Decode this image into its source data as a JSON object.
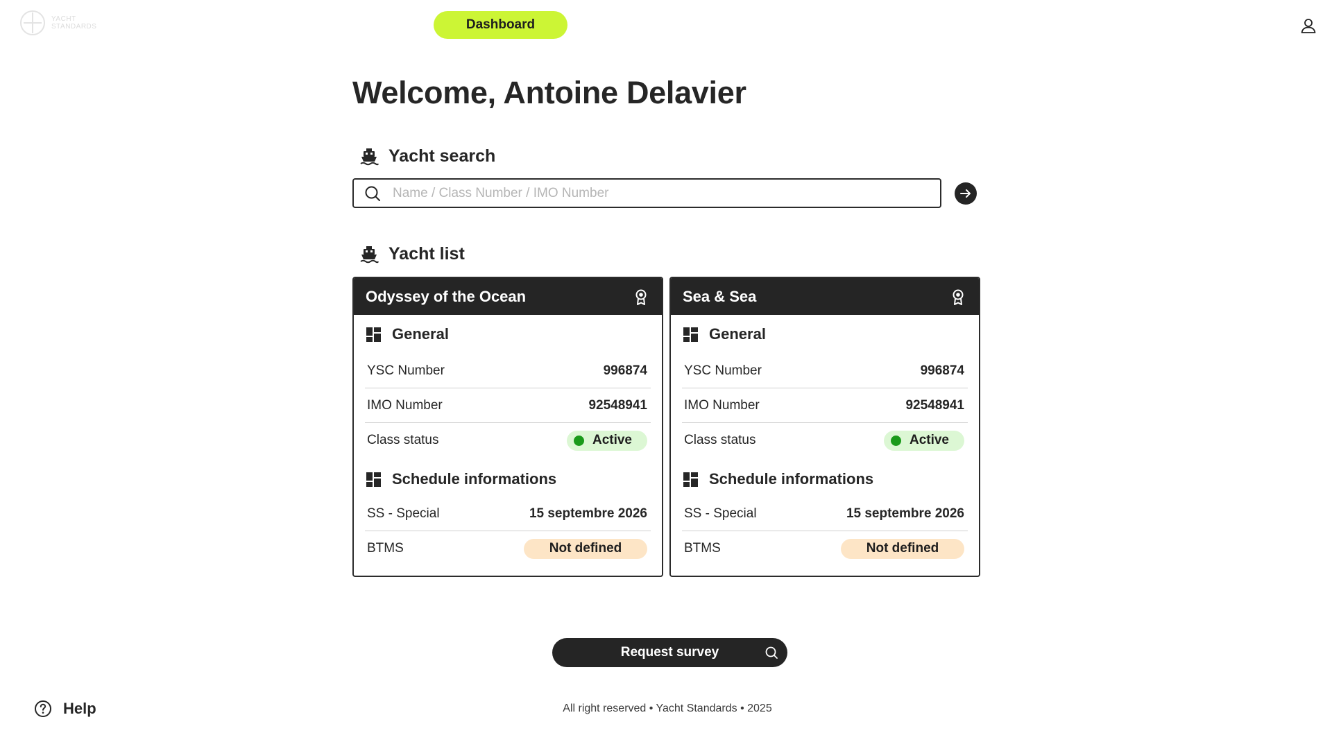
{
  "header": {
    "logo_text_line1": "YACHT",
    "logo_text_line2": "STANDARDS",
    "dashboard_label": "Dashboard"
  },
  "welcome": {
    "title": "Welcome, Antoine Delavier"
  },
  "search": {
    "title": "Yacht search",
    "placeholder": "Name / Class Number / IMO Number",
    "value": ""
  },
  "yacht_list": {
    "title": "Yacht list",
    "yachts": [
      {
        "name": "Odyssey of the Ocean",
        "general_title": "General",
        "ysc_label": "YSC Number",
        "ysc_value": "996874",
        "imo_label": "IMO Number",
        "imo_value": "92548941",
        "class_status_label": "Class status",
        "class_status_value": "Active",
        "schedule_title": "Schedule informations",
        "ss_label": "SS - Special",
        "ss_value": "15 septembre 2026",
        "btms_label": "BTMS",
        "btms_value": "Not defined"
      },
      {
        "name": "Sea & Sea",
        "general_title": "General",
        "ysc_label": "YSC Number",
        "ysc_value": "996874",
        "imo_label": "IMO Number",
        "imo_value": "92548941",
        "class_status_label": "Class status",
        "class_status_value": "Active",
        "schedule_title": "Schedule informations",
        "ss_label": "SS - Special",
        "ss_value": "15 septembre 2026",
        "btms_label": "BTMS",
        "btms_value": "Not defined"
      }
    ]
  },
  "actions": {
    "request_survey_label": "Request survey"
  },
  "help": {
    "label": "Help"
  },
  "footer": {
    "text": "All right reserved • Yacht Standards • 2025"
  },
  "colors": {
    "accent": "#ccf535",
    "dark": "#252525",
    "active_bg": "#dcf7d4",
    "active_dot": "#1a9a1a",
    "warning_bg": "#fde5c6"
  }
}
